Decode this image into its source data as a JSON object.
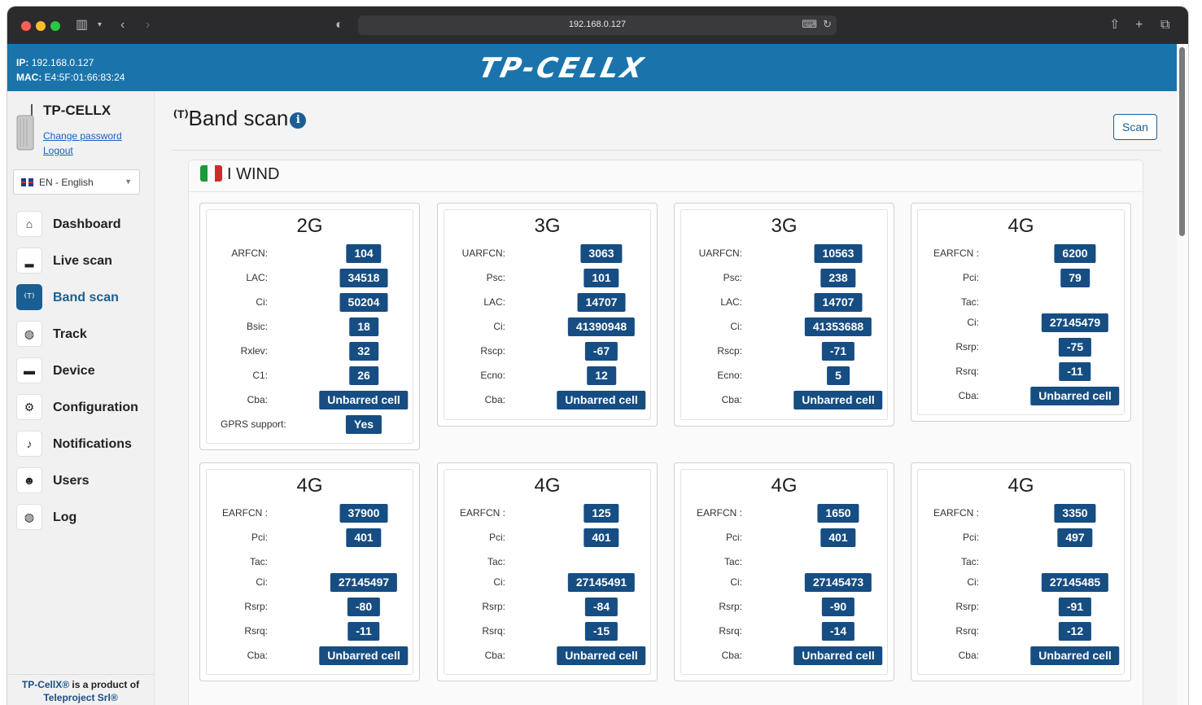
{
  "browser": {
    "url": "192.168.0.127"
  },
  "header": {
    "ip_label": "IP:",
    "ip": "192.168.0.127",
    "mac_label": "MAC:",
    "mac": "E4:5F:01:66:83:24",
    "logo": "TP-CELLX"
  },
  "sidebar": {
    "device_name": "TP-CELLX",
    "change_password": "Change password",
    "logout": "Logout",
    "language": "EN - English",
    "nav": [
      {
        "label": "Dashboard",
        "icon": "home-icon"
      },
      {
        "label": "Live scan",
        "icon": "signal-bars-icon"
      },
      {
        "label": "Band scan",
        "icon": "antenna-icon",
        "active": true
      },
      {
        "label": "Track",
        "icon": "compass-icon"
      },
      {
        "label": "Device",
        "icon": "hard-drive-icon"
      },
      {
        "label": "Configuration",
        "icon": "gears-icon"
      },
      {
        "label": "Notifications",
        "icon": "bell-icon"
      },
      {
        "label": "Users",
        "icon": "users-icon"
      },
      {
        "label": "Log",
        "icon": "compass-icon"
      }
    ],
    "footer_brand": "TP-CellX®",
    "footer_text": " is a product of",
    "footer_company": "Teleproject Srl®"
  },
  "main": {
    "title": "Band scan",
    "scan_button": "Scan",
    "operator": "I WIND",
    "cells": [
      {
        "tech": "2G",
        "rows": [
          {
            "k": "ARFCN:",
            "v": "104"
          },
          {
            "k": "LAC:",
            "v": "34518"
          },
          {
            "k": "Ci:",
            "v": "50204"
          },
          {
            "k": "Bsic:",
            "v": "18"
          },
          {
            "k": "Rxlev:",
            "v": "32"
          },
          {
            "k": "C1:",
            "v": "26"
          },
          {
            "k": "Cba:",
            "v": "Unbarred cell"
          },
          {
            "k": "GPRS support:",
            "v": "Yes"
          }
        ]
      },
      {
        "tech": "3G",
        "rows": [
          {
            "k": "UARFCN:",
            "v": "3063"
          },
          {
            "k": "Psc:",
            "v": "101"
          },
          {
            "k": "LAC:",
            "v": "14707"
          },
          {
            "k": "Ci:",
            "v": "41390948"
          },
          {
            "k": "Rscp:",
            "v": "-67"
          },
          {
            "k": "Ecno:",
            "v": "12"
          },
          {
            "k": "Cba:",
            "v": "Unbarred cell"
          }
        ]
      },
      {
        "tech": "3G",
        "rows": [
          {
            "k": "UARFCN:",
            "v": "10563"
          },
          {
            "k": "Psc:",
            "v": "238"
          },
          {
            "k": "LAC:",
            "v": "14707"
          },
          {
            "k": "Ci:",
            "v": "41353688"
          },
          {
            "k": "Rscp:",
            "v": "-71"
          },
          {
            "k": "Ecno:",
            "v": "5"
          },
          {
            "k": "Cba:",
            "v": "Unbarred cell"
          }
        ]
      },
      {
        "tech": "4G",
        "rows": [
          {
            "k": "EARFCN :",
            "v": "6200"
          },
          {
            "k": "Pci:",
            "v": "79"
          },
          {
            "k": "Tac:",
            "v": ""
          },
          {
            "k": "Ci:",
            "v": "27145479"
          },
          {
            "k": "Rsrp:",
            "v": "-75"
          },
          {
            "k": "Rsrq:",
            "v": "-11"
          },
          {
            "k": "Cba:",
            "v": "Unbarred cell"
          }
        ]
      },
      {
        "tech": "4G",
        "rows": [
          {
            "k": "EARFCN :",
            "v": "37900"
          },
          {
            "k": "Pci:",
            "v": "401"
          },
          {
            "k": "Tac:",
            "v": ""
          },
          {
            "k": "Ci:",
            "v": "27145497"
          },
          {
            "k": "Rsrp:",
            "v": "-80"
          },
          {
            "k": "Rsrq:",
            "v": "-11"
          },
          {
            "k": "Cba:",
            "v": "Unbarred cell"
          }
        ]
      },
      {
        "tech": "4G",
        "rows": [
          {
            "k": "EARFCN :",
            "v": "125"
          },
          {
            "k": "Pci:",
            "v": "401"
          },
          {
            "k": "Tac:",
            "v": ""
          },
          {
            "k": "Ci:",
            "v": "27145491"
          },
          {
            "k": "Rsrp:",
            "v": "-84"
          },
          {
            "k": "Rsrq:",
            "v": "-15"
          },
          {
            "k": "Cba:",
            "v": "Unbarred cell"
          }
        ]
      },
      {
        "tech": "4G",
        "rows": [
          {
            "k": "EARFCN :",
            "v": "1650"
          },
          {
            "k": "Pci:",
            "v": "401"
          },
          {
            "k": "Tac:",
            "v": ""
          },
          {
            "k": "Ci:",
            "v": "27145473"
          },
          {
            "k": "Rsrp:",
            "v": "-90"
          },
          {
            "k": "Rsrq:",
            "v": "-14"
          },
          {
            "k": "Cba:",
            "v": "Unbarred cell"
          }
        ]
      },
      {
        "tech": "4G",
        "rows": [
          {
            "k": "EARFCN :",
            "v": "3350"
          },
          {
            "k": "Pci:",
            "v": "497"
          },
          {
            "k": "Tac:",
            "v": ""
          },
          {
            "k": "Ci:",
            "v": "27145485"
          },
          {
            "k": "Rsrp:",
            "v": "-91"
          },
          {
            "k": "Rsrq:",
            "v": "-12"
          },
          {
            "k": "Cba:",
            "v": "Unbarred cell"
          }
        ]
      }
    ]
  },
  "colors": {
    "header_blue": "#1a74ab",
    "badge_blue": "#164d82",
    "accent": "#1a5f93"
  }
}
